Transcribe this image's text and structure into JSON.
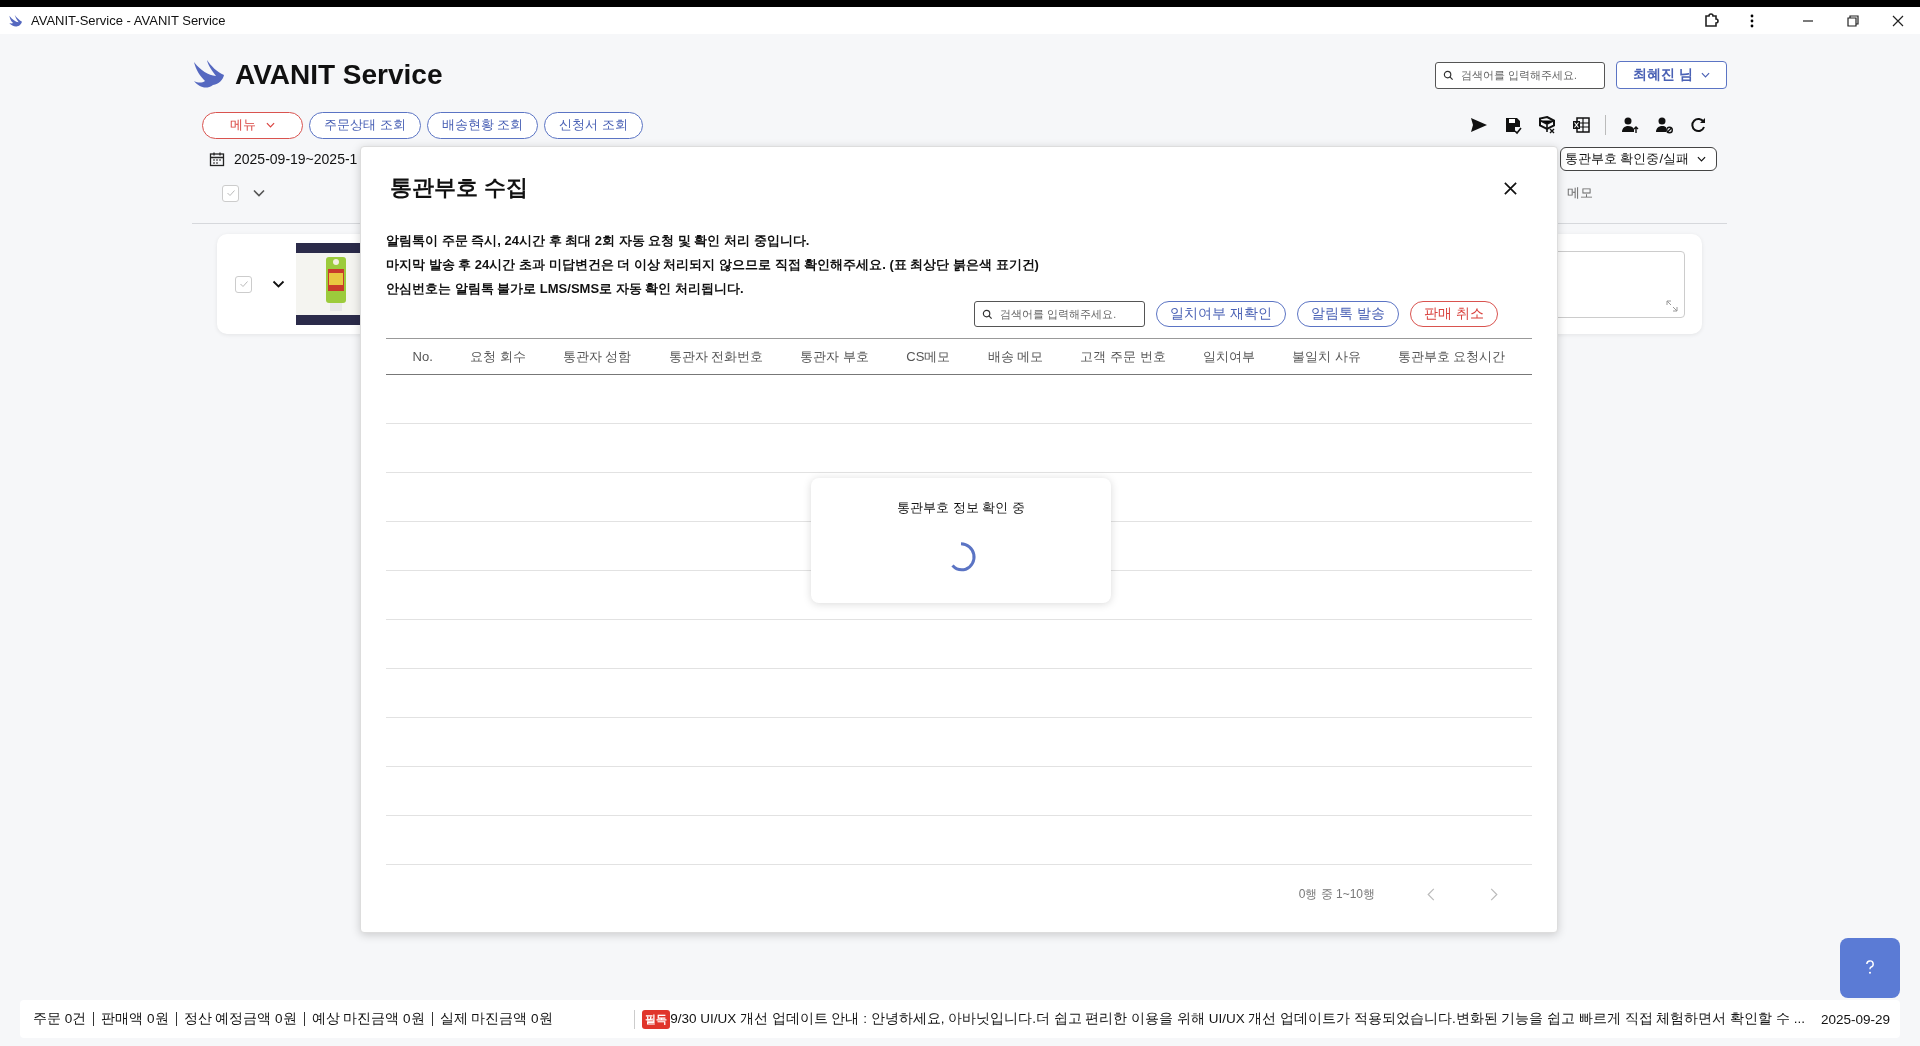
{
  "window": {
    "title": "AVANIT-Service - AVANIT Service"
  },
  "app": {
    "name": "AVANIT Service"
  },
  "header": {
    "search": {
      "placeholder": "검색어를 입력해주세요."
    },
    "user_button": "최혜진 님"
  },
  "nav": [
    {
      "label": "메뉴",
      "kind": "menu"
    },
    {
      "label": "주문상태 조회",
      "kind": "link"
    },
    {
      "label": "배송현황 조회",
      "kind": "link"
    },
    {
      "label": "신청서 조회",
      "kind": "link"
    }
  ],
  "filters": {
    "date_range": "2025-09-19~2025-1",
    "status_dropdown": "통관부호 확인중/실패"
  },
  "list_header": {
    "select_all_checked": false,
    "memo_column": "메모"
  },
  "order_card": {
    "checked": false
  },
  "dialog": {
    "title": "통관부호 수집",
    "notices": [
      "알림톡이 주문 즉시, 24시간 후 최대 2회 자동 요청 및 확인 처리 중입니다.",
      "마지막 발송 후 24시간 초과 미답변건은 더 이상 처리되지 않으므로 직접 확인해주세요. (표 최상단 붉은색 표기건)",
      "안심번호는 알림톡 불가로 LMS/SMS로 자동 확인 처리됩니다."
    ],
    "search": {
      "placeholder": "검색어를 입력해주세요."
    },
    "actions": [
      {
        "label": "일치여부 재확인",
        "kind": "primary"
      },
      {
        "label": "알림톡 발송",
        "kind": "primary"
      },
      {
        "label": "판매 취소",
        "kind": "danger"
      }
    ],
    "table": {
      "columns": [
        "No.",
        "요청 회수",
        "통관자 성함",
        "통관자 전화번호",
        "통관자 부호",
        "CS메모",
        "배송 메모",
        "고객 주문 번호",
        "일치여부",
        "불일치 사유",
        "통관부호 요청시간"
      ]
    },
    "loading": {
      "message": "통관부호 정보 확인 중"
    },
    "pagination": {
      "summary": "0행 중 1~10행",
      "prev_disabled": true,
      "next_disabled": true
    }
  },
  "status_bar": {
    "summary": [
      "주문 0건",
      "판매액 0원",
      "정산 예정금액 0원",
      "예상 마진금액 0원",
      "실제 마진금액 0원"
    ],
    "notice": {
      "badge": "필독",
      "text": "9/30 UI/UX 개선 업데이트 안내 : 안녕하세요, 아바닛입니다.더 쉽고 편리한 이용을 위해 UI/UX 개선 업데이트가 적용되었습니다.변화된 기능을 쉽고 빠르게 직접 체험하면서 확인할 수 ..."
    },
    "date": "2025-09-29"
  }
}
